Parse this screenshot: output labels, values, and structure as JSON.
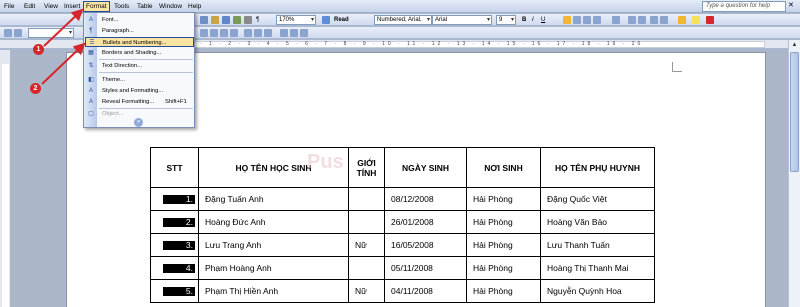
{
  "menubar": {
    "items": [
      {
        "label": "File"
      },
      {
        "label": "Edit"
      },
      {
        "label": "View"
      },
      {
        "label": "Insert"
      },
      {
        "label": "Format"
      },
      {
        "label": "Tools"
      },
      {
        "label": "Table"
      },
      {
        "label": "Window"
      },
      {
        "label": "Help"
      }
    ],
    "help_placeholder": "Type a question for help",
    "close_glyph": "✕"
  },
  "toolbar1": {
    "zoom": "170%",
    "read_label": "Read",
    "style": "Numbered, Arial,",
    "font": "Arial",
    "size": "9",
    "bold": "B",
    "italic": "I",
    "underline": "U"
  },
  "format_menu": {
    "items": [
      {
        "label": "Font...",
        "icon": "A",
        "icon_name": "font-icon"
      },
      {
        "label": "Paragraph...",
        "icon": "¶",
        "icon_name": "paragraph-icon"
      },
      {
        "label": "Bullets and Numbering...",
        "icon": "☰",
        "icon_name": "bullets-icon"
      },
      {
        "label": "Borders and Shading...",
        "icon": "▦",
        "icon_name": "borders-icon"
      },
      {
        "label": "Text Direction...",
        "icon": "⇅",
        "icon_name": "text-direction-icon"
      },
      {
        "label": "Theme...",
        "icon": "◧",
        "icon_name": "theme-icon"
      },
      {
        "label": "Styles and Formatting...",
        "icon": "A",
        "icon_name": "styles-icon"
      },
      {
        "label": "Reveal Formatting...",
        "shortcut": "Shift+F1",
        "icon": "A",
        "icon_name": "reveal-formatting-icon"
      },
      {
        "label": "Object...",
        "icon": "▢",
        "icon_name": "object-icon"
      }
    ],
    "more_glyph": "»"
  },
  "callouts": [
    {
      "number": "1"
    },
    {
      "number": "2"
    }
  ],
  "watermark": "Pus",
  "ruler_numbers": "· 1 · 2 · 3 · 4 · 5 · 6 · 7 · 8 · 9 · 10 · 11 · 12 · 13 · 14 · 15 · 16 · 17 · 18 · 19 · 20",
  "table": {
    "headers": [
      "STT",
      "HỌ TÊN HỌC SINH",
      "GIỚI TÍNH",
      "NGÀY SINH",
      "NƠI SINH",
      "HỌ TÊN PHỤ HUYNH"
    ],
    "rows": [
      {
        "stt": "1.",
        "name": "Đặng Tuấn Anh",
        "gender": "",
        "dob": "08/12/2008",
        "place": "Hải Phòng",
        "parent": "Đặng Quốc Việt"
      },
      {
        "stt": "2.",
        "name": "Hoàng Đức Anh",
        "gender": "",
        "dob": "26/01/2008",
        "place": "Hải Phòng",
        "parent": "Hoàng Văn Bảo"
      },
      {
        "stt": "3.",
        "name": "Lưu Trang Anh",
        "gender": "Nữ",
        "dob": "16/05/2008",
        "place": "Hải Phòng",
        "parent": "Lưu Thanh Tuấn"
      },
      {
        "stt": "4.",
        "name": "Phạm Hoàng Anh",
        "gender": "",
        "dob": "05/11/2008",
        "place": "Hải Phòng",
        "parent": "Hoàng Thị Thanh Mai"
      },
      {
        "stt": "5.",
        "name": "Phạm Thị Hiền Anh",
        "gender": "Nữ",
        "dob": "04/11/2008",
        "place": "Hải Phòng",
        "parent": "Nguyễn Quỳnh Hoa"
      }
    ]
  },
  "colors": {
    "highlight": "#fbe3a2",
    "accent": "#1f4e9e",
    "callout": "#d7262b"
  }
}
